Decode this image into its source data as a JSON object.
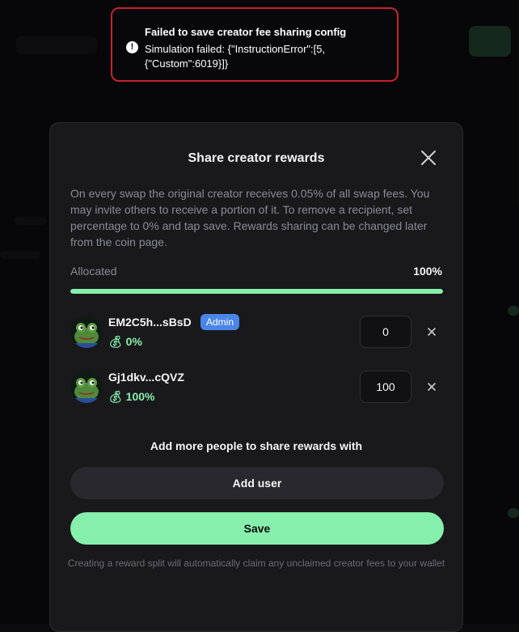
{
  "toast": {
    "title": "Failed to save creator fee sharing config",
    "message": "Simulation failed: {\"InstructionError\":[5, {\"Custom\":6019}]}"
  },
  "modal": {
    "title": "Share creator rewards",
    "description": "On every swap the original creator receives 0.05% of all swap fees. You may invite others to receive a portion of it. To remove a recipient, set percentage to 0% and tap save. Rewards sharing can be changed later from the coin page.",
    "allocated_label": "Allocated",
    "allocated_value": "100%",
    "allocated_fraction": 1.0,
    "recipients": [
      {
        "name": "EM2C5h...sBsD",
        "badge": "Admin",
        "percent_display": "0%",
        "input_value": "0"
      },
      {
        "name": "Gj1dkv...cQVZ",
        "badge": "",
        "percent_display": "100%",
        "input_value": "100"
      }
    ],
    "add_more_label": "Add more people to share rewards with",
    "add_user_label": "Add user",
    "save_label": "Save",
    "footnote": "Creating a reward split will automatically claim any unclaimed creator fees to your wallet"
  },
  "colors": {
    "accent": "#86efac",
    "error_border": "#c8222c",
    "admin_badge": "#4a86e8",
    "modal_bg": "#19191c"
  },
  "icons": {
    "toast": "exclamation-circle-icon",
    "close": "close-icon",
    "remove": "remove-icon",
    "percent": "money-bag-icon"
  }
}
